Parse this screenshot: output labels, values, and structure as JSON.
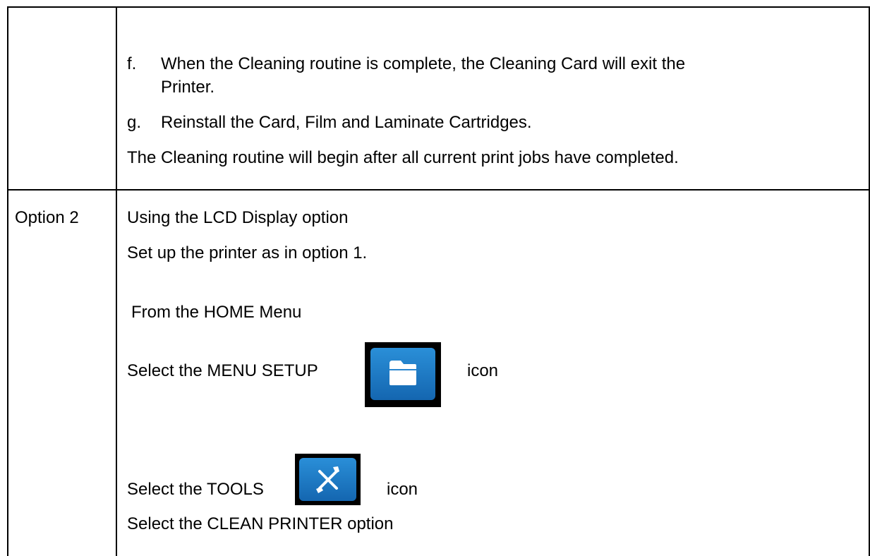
{
  "row1": {
    "item_f_marker": "f.",
    "item_f_line1": "When the Cleaning routine is complete, the Cleaning Card will exit the",
    "item_f_line2": "Printer.",
    "item_g_marker": "g.",
    "item_g_text": "Reinstall the Card, Film and Laminate Cartridges.",
    "note": "The Cleaning routine will begin after all current print jobs have completed."
  },
  "row2": {
    "label": "Option 2",
    "heading": "Using the LCD Display option",
    "setup": "Set up the printer as in option 1.",
    "from_home": "From the HOME Menu",
    "menu_setup_before": "Select the MENU SETUP",
    "menu_setup_after": "icon",
    "tools_before": "Select the TOOLS",
    "tools_after": "icon",
    "clean": "Select the CLEAN PRINTER option"
  },
  "icons": {
    "menu_setup": "folder-icon",
    "tools": "tools-icon"
  }
}
